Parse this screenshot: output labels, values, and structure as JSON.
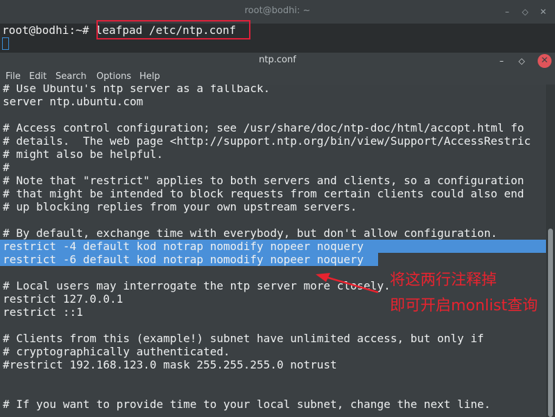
{
  "terminal": {
    "title": "root@bodhi: ~",
    "prompt": "root@bodhi:~# ",
    "command": "leafpad /etc/ntp.conf",
    "buttons": {
      "minimize": "–",
      "maximize": "◇",
      "close": "✕"
    }
  },
  "editor": {
    "title": "ntp.conf",
    "buttons": {
      "minimize": "–",
      "maximize": "◇",
      "close": "✕"
    },
    "menu": [
      "File",
      "Edit",
      "Search",
      "Options",
      "Help"
    ],
    "lines": [
      "# Use Ubuntu's ntp server as a fallback.",
      "server ntp.ubuntu.com",
      "",
      "# Access control configuration; see /usr/share/doc/ntp-doc/html/accopt.html fo",
      "# details.  The web page <http://support.ntp.org/bin/view/Support/AccessRestric",
      "# might also be helpful.",
      "#",
      "# Note that \"restrict\" applies to both servers and clients, so a configuration",
      "# that might be intended to block requests from certain clients could also end",
      "# up blocking replies from your own upstream servers.",
      "",
      "# By default, exchange time with everybody, but don't allow configuration.",
      "restrict -4 default kod notrap nomodify nopeer noquery",
      "restrict -6 default kod notrap nomodify nopeer noquery",
      "",
      "# Local users may interrogate the ntp server more closely.",
      "restrict 127.0.0.1",
      "restrict ::1",
      "",
      "# Clients from this (example!) subnet have unlimited access, but only if",
      "# cryptographically authenticated.",
      "#restrict 192.168.123.0 mask 255.255.255.0 notrust",
      "",
      "",
      "# If you want to provide time to your local subnet, change the next line."
    ],
    "selected_lines": [
      12,
      13
    ]
  },
  "annotation": {
    "line1": "将这两行注释掉",
    "line2": "即可开启monlist查询",
    "color": "#e8232f"
  },
  "colors": {
    "selection": "#4a90d9",
    "highlight_box": "#e0203a",
    "close_button": "#e0545a"
  }
}
